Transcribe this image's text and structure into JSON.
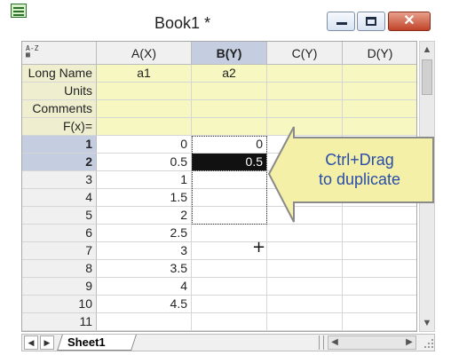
{
  "window": {
    "title": "Book1 *",
    "controls": {
      "minimize": "minimize",
      "maximize": "maximize",
      "close": "✕"
    }
  },
  "grid": {
    "columns": [
      {
        "header": "A(X)",
        "selected": false
      },
      {
        "header": "B(Y)",
        "selected": true
      },
      {
        "header": "C(Y)",
        "selected": false
      },
      {
        "header": "D(Y)",
        "selected": false
      }
    ],
    "meta_rows": [
      {
        "label": "Long Name",
        "values": [
          "a1",
          "a2",
          "",
          ""
        ]
      },
      {
        "label": "Units",
        "values": [
          "",
          "",
          "",
          ""
        ]
      },
      {
        "label": "Comments",
        "values": [
          "",
          "",
          "",
          ""
        ]
      },
      {
        "label": "F(x)=",
        "values": [
          "",
          "",
          "",
          ""
        ]
      }
    ],
    "rows": [
      {
        "index": "1",
        "values": [
          "0",
          "0",
          "",
          ""
        ]
      },
      {
        "index": "2",
        "values": [
          "0.5",
          "0.5",
          "",
          ""
        ]
      },
      {
        "index": "3",
        "values": [
          "1",
          "",
          "",
          ""
        ]
      },
      {
        "index": "4",
        "values": [
          "1.5",
          "",
          "",
          ""
        ]
      },
      {
        "index": "5",
        "values": [
          "2",
          "",
          "",
          ""
        ]
      },
      {
        "index": "6",
        "values": [
          "2.5",
          "",
          "",
          ""
        ]
      },
      {
        "index": "7",
        "values": [
          "3",
          "",
          "",
          ""
        ]
      },
      {
        "index": "8",
        "values": [
          "3.5",
          "",
          "",
          ""
        ]
      },
      {
        "index": "9",
        "values": [
          "4",
          "",
          "",
          ""
        ]
      },
      {
        "index": "10",
        "values": [
          "4.5",
          "",
          "",
          ""
        ]
      },
      {
        "index": "11",
        "values": [
          "",
          "",
          "",
          ""
        ]
      }
    ]
  },
  "sheet_tabs": [
    {
      "label": "Sheet1",
      "active": true
    }
  ],
  "callout": {
    "line1": "Ctrl+Drag",
    "line2": "to duplicate",
    "color": "#2a4da8",
    "fill": "#f4f0a8"
  },
  "icons": {
    "crosshair": "+"
  }
}
